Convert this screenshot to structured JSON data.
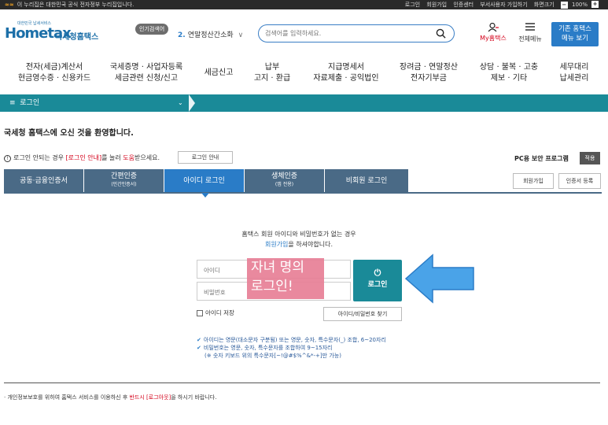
{
  "topbar": {
    "gov_text": "이 누리집은 대한민국 공식 전자정부 누리집입니다.",
    "links": [
      "로그인",
      "회원가입",
      "인증센터",
      "부서사용자 가입하기",
      "화면크기"
    ],
    "zoom_minus": "−",
    "zoom": "100%",
    "zoom_plus": "+"
  },
  "logo": {
    "tagline": "대한민국 납세서비스",
    "brand": "Hometax",
    "name": "국세청홈택스"
  },
  "header": {
    "popular_badge": "인기검색어",
    "popular_rank": "2.",
    "popular_term": "연말정산간소화",
    "search_placeholder": "검색어를 입력하세요.",
    "my_home": "My홈택스",
    "all_menu": "전체메뉴",
    "old_hometax": [
      "기존 홈택스",
      "메뉴 보기"
    ]
  },
  "gnb": [
    [
      "전자(세금)계산서",
      "현금영수증 · 신용카드"
    ],
    [
      "국세증명 · 사업자등록",
      "세금관련 신청/신고"
    ],
    [
      "세금신고",
      ""
    ],
    [
      "납부",
      "고지 · 환급"
    ],
    [
      "지급명세서",
      "자료제출 · 공익법인"
    ],
    [
      "장려금 · 연말정산",
      "전자기부금"
    ],
    [
      "상담 · 불복 · 고충",
      "제보 · 기타"
    ],
    [
      "세무대리",
      "납세관리"
    ]
  ],
  "location": {
    "menu_icon": "≡",
    "label": "로그인",
    "dropdown": "⌄"
  },
  "welcome": "국세청 홈택스에 오신 것을 환영합니다.",
  "notice": {
    "pre": "로그인 안되는 경우 ",
    "red1": "[로그인 안내]",
    "mid": "를 눌러 ",
    "red2": "도움",
    "post": "받으세요.",
    "guide_button": "로그인 안내"
  },
  "pc_security": {
    "label": "PC용 보안 프로그램",
    "apply": "적용"
  },
  "tabs": [
    {
      "label": "공동·금융인증서",
      "sub": ""
    },
    {
      "label": "간편인증",
      "sub": "(민간인증서)"
    },
    {
      "label": "아이디 로그인",
      "sub": ""
    },
    {
      "label": "생체인증",
      "sub": "(앱 전용)"
    },
    {
      "label": "비회원 로그인",
      "sub": ""
    }
  ],
  "side_buttons": {
    "signup": "회원가입",
    "cert_register": "인증서 등록"
  },
  "login": {
    "info_line1": "홈택스 회원 아이디와 비밀번호가 없는 경우",
    "info_link": "회원가입",
    "info_line2_rest": "을 하셔야합니다.",
    "id_placeholder": "아이디",
    "pw_placeholder": "비밀번호",
    "overlay_line1": "자녀 명의",
    "overlay_line2": "로그인!",
    "button": "로그인",
    "power_icon": "⏻",
    "keep_id": "아이디 저장",
    "find_button": "아이디/비밀번호 찾기"
  },
  "rules": [
    "아이디는 영문(대소문자 구분됨) 또는 영문, 숫자, 특수문자(_) 조합, 6~20자리",
    "비밀번호는 영문, 숫자, 특수문자를 조합하여 9~15자리",
    "(※ 숫자 키보드 위의 특수문자[~!@#$%^&*-+]만 가능)"
  ],
  "footer": {
    "pre": "· 개인정보보호를 위하여 홈택스 서비스를 이용하신 후 ",
    "red": "반드시 [로그아웃]",
    "post": "을 하시기 바랍니다."
  },
  "colors": {
    "teal": "#1a8a98",
    "blue": "#2a7cc7",
    "tab": "#4a6a86",
    "overlay": "#e87f96",
    "arrow": "#4aa3e8"
  }
}
